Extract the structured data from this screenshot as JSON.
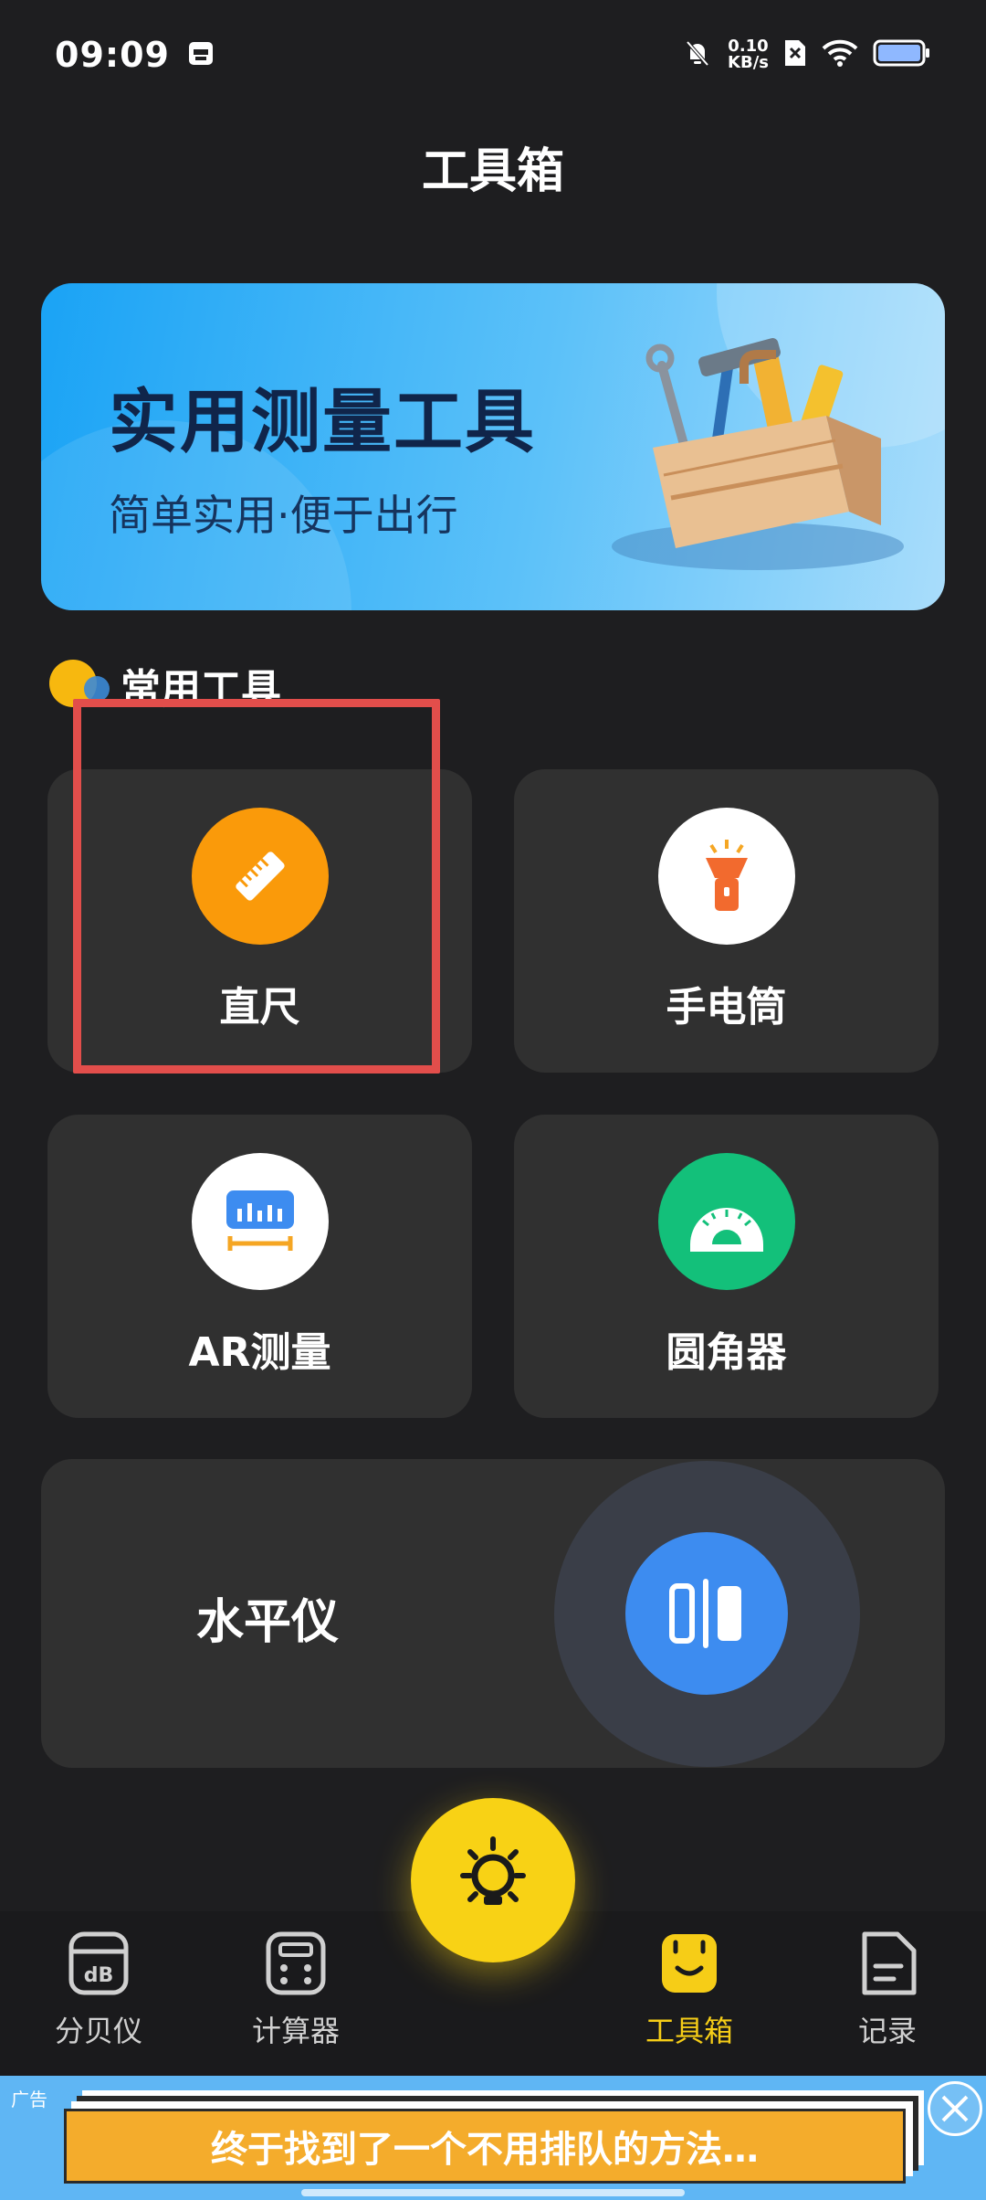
{
  "status_bar": {
    "time": "09:09",
    "net_speed_value": "0.10",
    "net_speed_unit": "KB/s",
    "icons": [
      "calendar-icon",
      "mute-bell-icon",
      "sim-off-icon",
      "wifi-icon",
      "battery-icon"
    ]
  },
  "header": {
    "title": "工具箱"
  },
  "banner": {
    "title": "实用测量工具",
    "subtitle": "简单实用·便于出行"
  },
  "section": {
    "title": "常用工具"
  },
  "tools": [
    {
      "label": "直尺",
      "icon": "ruler-icon",
      "color": "#fa9a0a"
    },
    {
      "label": "手电筒",
      "icon": "flashlight-icon",
      "color": "#ffffff"
    },
    {
      "label": "AR测量",
      "icon": "ar-measure-icon",
      "color": "#ffffff"
    },
    {
      "label": "圆角器",
      "icon": "protractor-icon",
      "color": "#13c07a"
    }
  ],
  "level": {
    "label": "水平仪",
    "icon": "level-icon",
    "color": "#3d8cf0"
  },
  "fab": {
    "icon": "light-bulb-icon",
    "color": "#f8d215"
  },
  "bottom_nav": {
    "items": [
      {
        "label": "分贝仪",
        "icon": "decibel-icon"
      },
      {
        "label": "计算器",
        "icon": "calculator-icon"
      },
      {
        "label": "工具箱",
        "icon": "toolbox-icon",
        "active": true
      },
      {
        "label": "记录",
        "icon": "record-icon"
      }
    ],
    "active_color": "#f6cd17"
  },
  "ad": {
    "tag": "广告",
    "text": "终于找到了一个不用排队的方法…"
  }
}
